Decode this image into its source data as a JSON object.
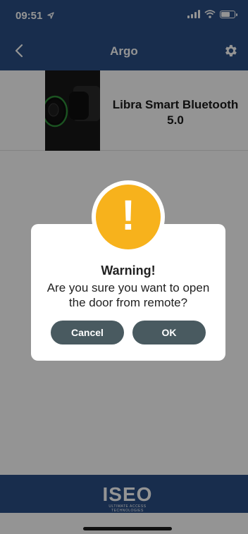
{
  "status_bar": {
    "time": "09:51"
  },
  "nav": {
    "title": "Argo"
  },
  "device": {
    "name_line1": "Libra Smart Bluetooth",
    "name_line2": "5.0"
  },
  "dialog": {
    "title": "Warning!",
    "message_line1": "Are you sure you want to open",
    "message_line2": "the door from remote?",
    "cancel_label": "Cancel",
    "ok_label": "OK",
    "warning_mark": "!"
  },
  "footer": {
    "logo_text": "ISEO",
    "logo_tagline": "ULTIMATE ACCESS TECHNOLOGIES"
  },
  "colors": {
    "brand_blue": "#2a4f86",
    "warning_yellow": "#f7b21c",
    "button_gray": "#495a60"
  },
  "icons": [
    "location-arrow-icon",
    "signal-icon",
    "wifi-icon",
    "battery-icon",
    "back-chevron-icon",
    "gear-icon",
    "warning-icon"
  ]
}
